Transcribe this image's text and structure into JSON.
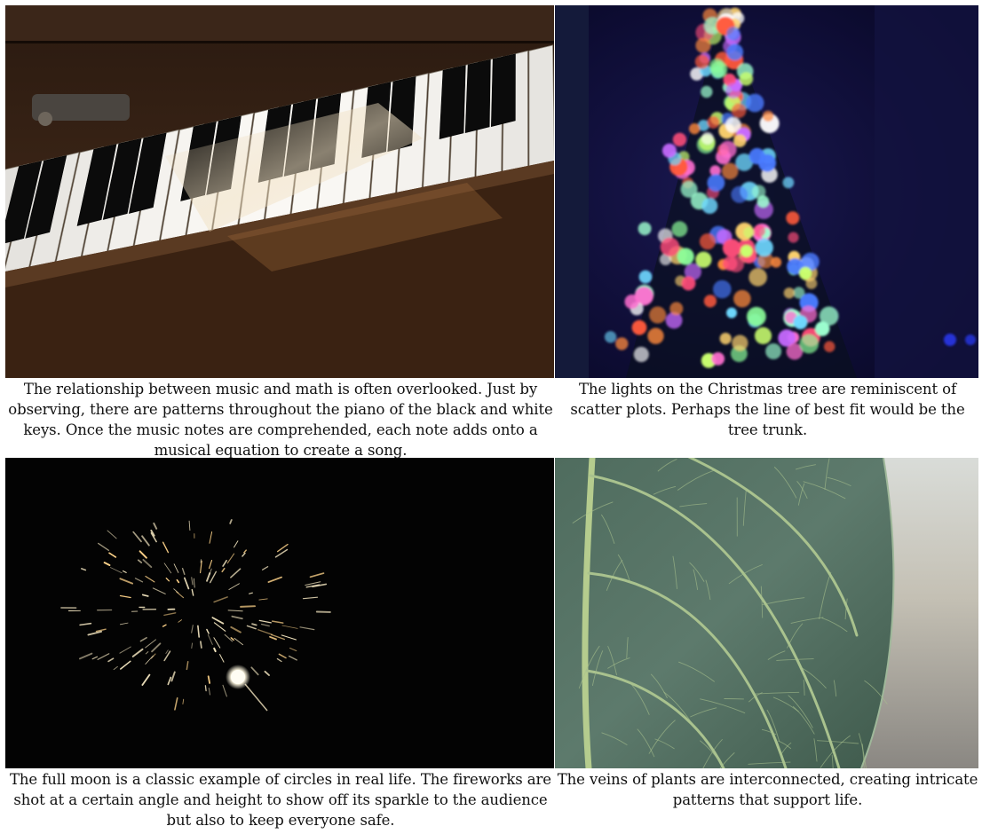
{
  "panels": [
    {
      "subject": "piano-keys",
      "caption": "The relationship between music and math is often overlooked. Just by observing, there are patterns throughout the piano of the black and white keys. Once the music notes are comprehended, each note adds onto a musical equation to create a song."
    },
    {
      "subject": "christmas-tree-lights",
      "caption": "The lights on the Christmas tree are reminiscent of scatter plots. Perhaps the line of best fit would be the tree trunk."
    },
    {
      "subject": "fireworks-and-full-moon",
      "caption": "The full moon is a classic example of circles in real life. The fireworks are shot at a certain angle and height to show off its sparkle to the audience but also to keep everyone safe."
    },
    {
      "subject": "leaf-veins",
      "caption": "The veins of plants are interconnected, creating intricate patterns that support life."
    }
  ]
}
